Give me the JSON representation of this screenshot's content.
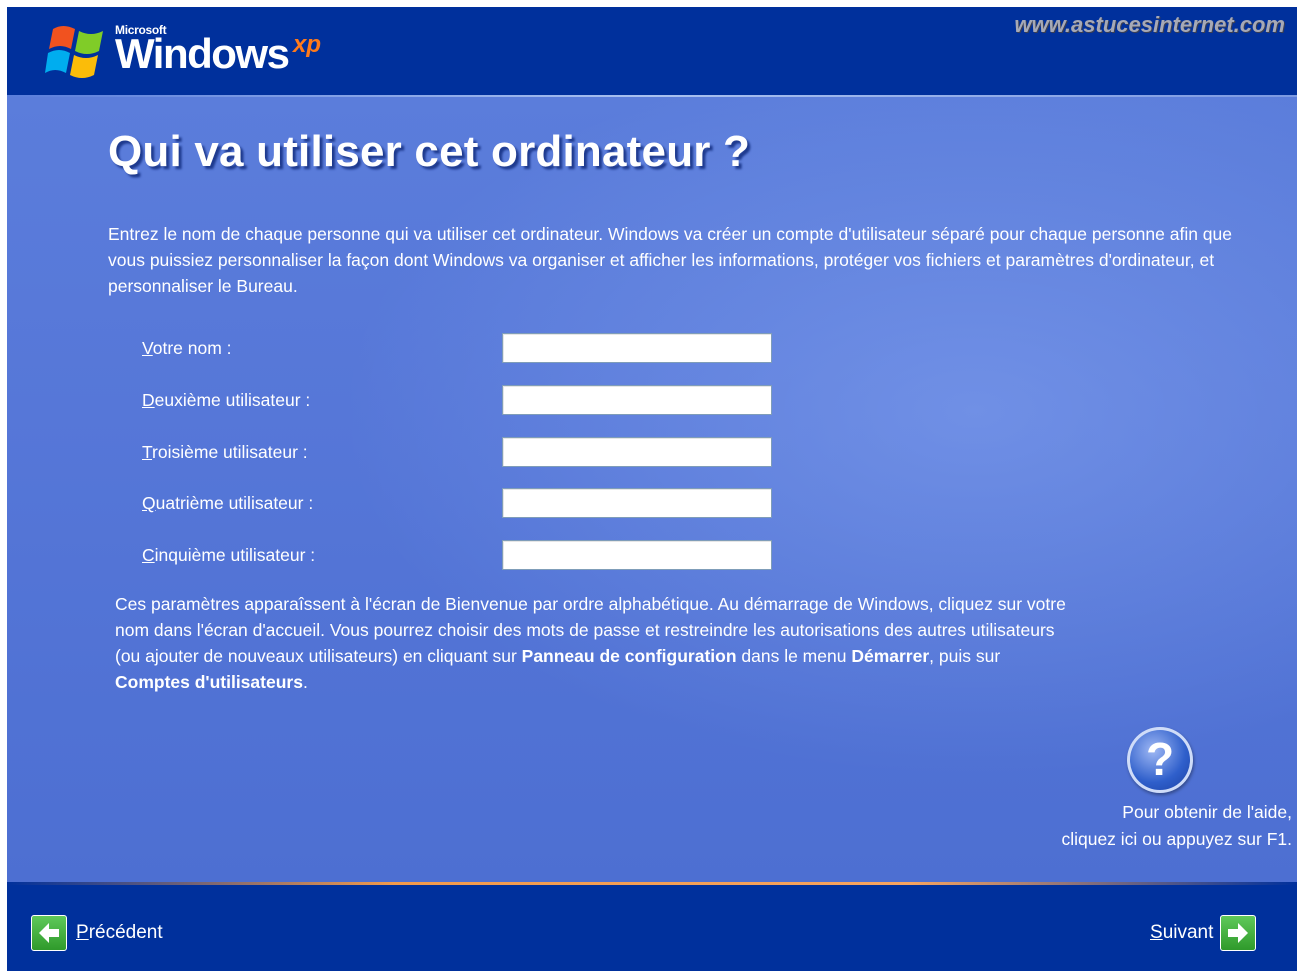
{
  "header": {
    "logo_microsoft": "Microsoft",
    "logo_windows": "Windows",
    "logo_xp": "xp",
    "watermark": "www.astucesinternet.com"
  },
  "main": {
    "title": "Qui va utiliser cet ordinateur ?",
    "intro": "Entrez le nom de chaque personne qui va utiliser cet ordinateur. Windows va créer un compte d'utilisateur séparé pour chaque personne afin que vous puissiez personnaliser la façon dont Windows va organiser et afficher les informations, protéger vos fichiers et paramètres d'ordinateur, et personnaliser le Bureau.",
    "fields": [
      {
        "accel": "V",
        "rest": "otre nom :",
        "value": ""
      },
      {
        "accel": "D",
        "rest": "euxième utilisateur :",
        "value": ""
      },
      {
        "accel": "T",
        "rest": "roisième utilisateur :",
        "value": ""
      },
      {
        "accel": "Q",
        "rest": "uatrième utilisateur :",
        "value": ""
      },
      {
        "accel": "C",
        "rest": "inquième utilisateur :",
        "value": ""
      }
    ],
    "note": {
      "part1": "Ces paramètres apparaîssent à l'écran de Bienvenue par ordre alphabétique. Au démarrage de Windows, cliquez sur votre nom dans l'écran d'accueil. Vous pourrez choisir des mots de passe et restreindre les autorisations des autres utilisateurs (ou ajouter de nouveaux utilisateurs) en cliquant sur ",
      "bold1": "Panneau de configuration",
      "part2": " dans le menu ",
      "bold2": "Démarrer",
      "part3": ", puis sur ",
      "bold3": "Comptes d'utilisateurs",
      "part4": "."
    },
    "help": {
      "icon_glyph": "?",
      "line1": "Pour obtenir de l'aide,",
      "line2": "cliquez ici ou appuyez sur F1."
    }
  },
  "footer": {
    "back": {
      "accel": "P",
      "rest": "récédent"
    },
    "next": {
      "accel": "S",
      "rest": "uivant"
    }
  },
  "colors": {
    "header_bg": "#00309c",
    "main_bg": "#5677d8",
    "footer_line": "#f29a4b",
    "button_green": "#2f9a2b"
  }
}
